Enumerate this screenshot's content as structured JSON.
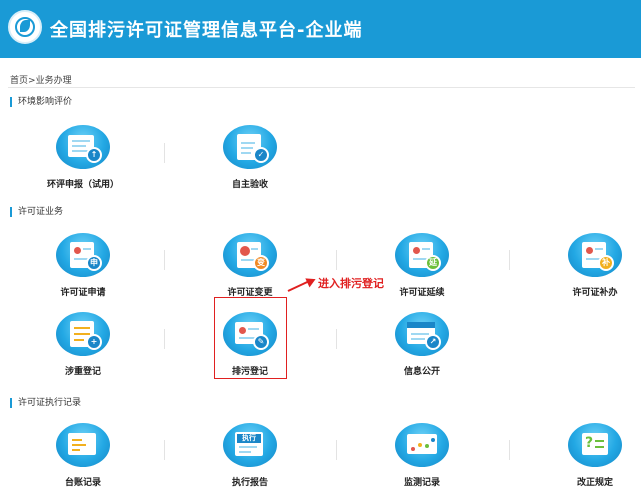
{
  "header": {
    "title": "全国排污许可证管理信息平台-企业端"
  },
  "breadcrumb": {
    "home": "首页",
    "sep": ">",
    "current": "业务办理"
  },
  "sections": [
    {
      "title": "环境影响评价",
      "items": [
        {
          "label": "环评申报（试用）",
          "icon": "report-upload-icon"
        },
        {
          "label": "自主验收",
          "icon": "acceptance-check-icon"
        }
      ]
    },
    {
      "title": "许可证业务",
      "items": [
        {
          "label": "许可证申请",
          "icon": "license-apply-icon",
          "badge": "申"
        },
        {
          "label": "许可证变更",
          "icon": "license-change-icon",
          "badge": "变"
        },
        {
          "label": "许可证延续",
          "icon": "license-extend-icon",
          "badge": "延"
        },
        {
          "label": "许可证补办",
          "icon": "license-reissue-icon",
          "badge": "补"
        },
        {
          "label": "涉重登记",
          "icon": "heavy-metal-register-icon",
          "badge": "+"
        },
        {
          "label": "排污登记",
          "icon": "pollution-register-icon",
          "badge": "✎"
        },
        {
          "label": "信息公开",
          "icon": "news-publish-icon",
          "badge": "↗",
          "news": "NEWS"
        }
      ]
    },
    {
      "title": "许可证执行记录",
      "items": [
        {
          "label": "台账记录",
          "icon": "ledger-record-icon"
        },
        {
          "label": "执行报告",
          "icon": "execution-report-icon",
          "tag": "执行"
        },
        {
          "label": "监测记录",
          "icon": "monitoring-record-icon"
        },
        {
          "label": "改正规定",
          "icon": "correction-rule-icon",
          "glyph": "?"
        }
      ]
    }
  ],
  "annotation": {
    "text": "进入排污登记"
  },
  "colors": {
    "brand": "#1a9ad6",
    "annotation": "#e02020"
  }
}
